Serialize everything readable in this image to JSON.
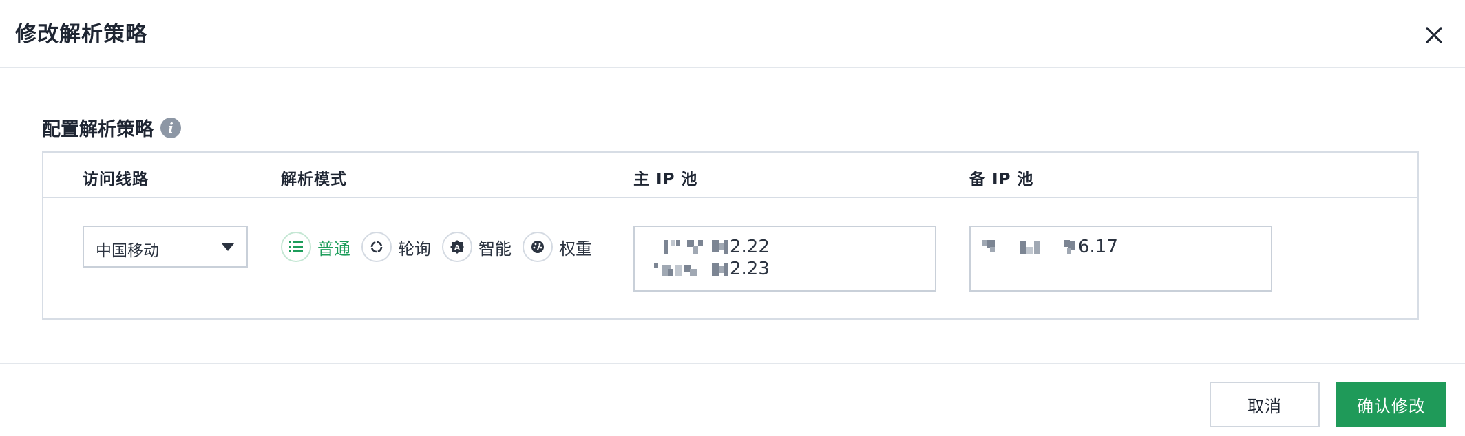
{
  "dialog": {
    "title": "修改解析策略"
  },
  "section": {
    "title": "配置解析策略",
    "info_icon": "info-icon"
  },
  "table": {
    "headers": {
      "line": "访问线路",
      "mode": "解析模式",
      "primary_pool": "主 IP 池",
      "backup_pool": "备 IP 池"
    },
    "row": {
      "line_select": "中国移动",
      "modes": [
        {
          "label": "普通",
          "icon": "list-icon",
          "selected": true
        },
        {
          "label": "轮询",
          "icon": "round-robin-icon",
          "selected": false
        },
        {
          "label": "智能",
          "icon": "smart-icon",
          "selected": false
        },
        {
          "label": "权重",
          "icon": "gauge-icon",
          "selected": false
        }
      ],
      "primary_ips": [
        "2.22",
        "2.23"
      ],
      "backup_ips": [
        "6.17"
      ]
    }
  },
  "footer": {
    "cancel_label": "取消",
    "confirm_label": "确认修改"
  },
  "colors": {
    "accent": "#1f9a59",
    "active_text": "#1d9d5b",
    "border": "#d7dde5"
  }
}
